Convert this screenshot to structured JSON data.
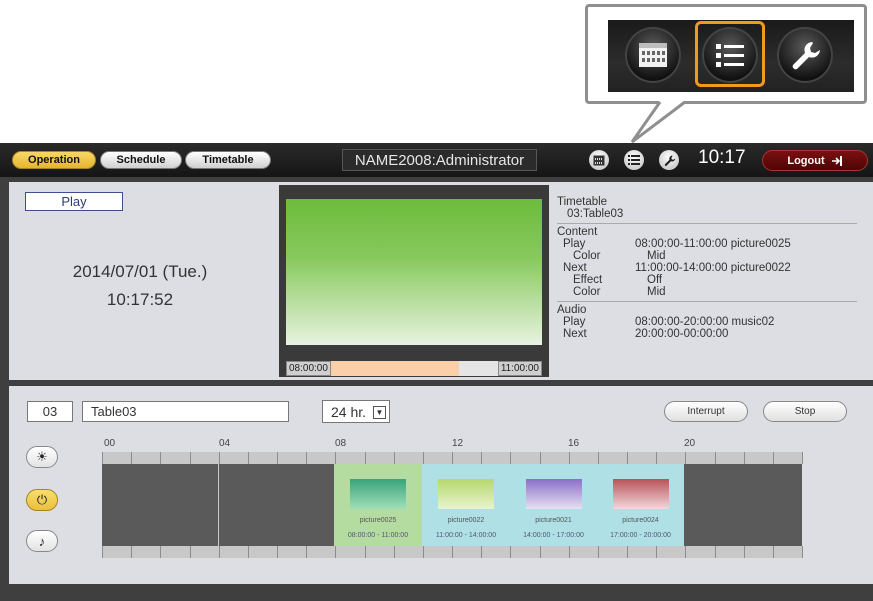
{
  "header": {
    "tabs": [
      {
        "label": "Operation",
        "active": true
      },
      {
        "label": "Schedule",
        "active": false
      },
      {
        "label": "Timetable",
        "active": false
      }
    ],
    "user": "NAME2008:Administrator",
    "clock": "10:17",
    "logout_label": "Logout",
    "icons": [
      "calendar-icon",
      "list-icon",
      "wrench-icon"
    ]
  },
  "status": {
    "play_label": "Play",
    "date": "2014/07/01 (Tue.)",
    "time": "10:17:52"
  },
  "preview": {
    "start": "08:00:00",
    "end": "11:00:00",
    "progress_fraction": 0.77
  },
  "info": {
    "timetable_label": "Timetable",
    "timetable_value": "03:Table03",
    "content_label": "Content",
    "content_rows": [
      {
        "label": "Play",
        "value": "08:00:00-11:00:00  picture0025"
      },
      {
        "label": "Color",
        "value": "Mid"
      },
      {
        "label": "Next",
        "value": "11:00:00-14:00:00  picture0022"
      },
      {
        "label": "Effect",
        "value": "Off"
      },
      {
        "label": "Color",
        "value": "Mid"
      }
    ],
    "audio_label": "Audio",
    "audio_rows": [
      {
        "label": "Play",
        "value": "08:00:00-20:00:00  music02"
      },
      {
        "label": "Next",
        "value": "20:00:00-00:00:00"
      }
    ]
  },
  "table": {
    "number": "03",
    "name": "Table03",
    "range_option": "24 hr.",
    "interrupt_label": "Interrupt",
    "stop_label": "Stop"
  },
  "timeline": {
    "hour_labels": [
      "00",
      "04",
      "08",
      "12",
      "16",
      "20"
    ],
    "slots": [
      {
        "name": "picture0025",
        "range": "08:00:00 - 11:00:00",
        "thumb_from": "#3aa37a",
        "thumb_to": "#9fe0b8",
        "bg": "#b5dca0"
      },
      {
        "name": "picture0022",
        "range": "11:00:00 - 14:00:00",
        "thumb_from": "#b7d86e",
        "thumb_to": "#e7f3cf",
        "bg": "#aee0e6"
      },
      {
        "name": "picture0021",
        "range": "14:00:00 - 17:00:00",
        "thumb_from": "#8a6fc7",
        "thumb_to": "#e7e1f3",
        "bg": "#aee0e6"
      },
      {
        "name": "picture0024",
        "range": "17:00:00 - 20:00:00",
        "thumb_from": "#b8535a",
        "thumb_to": "#f1d9db",
        "bg": "#aee0e6"
      }
    ],
    "side_icons": [
      "sun-icon",
      "power-icon",
      "music-note-icon"
    ]
  }
}
